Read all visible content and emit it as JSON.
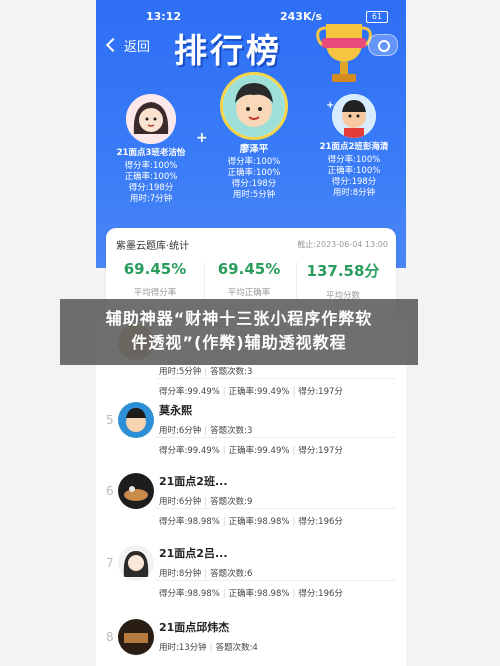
{
  "status_bar": {
    "time": "13:12",
    "network": "243K/s",
    "battery": "61"
  },
  "nav": {
    "back_label": "返回",
    "title": "排行榜"
  },
  "podium": [
    {
      "rank": 1,
      "name": "廖泽平",
      "score_rate": "得分率:100%",
      "correct_rate": "正确率:100%",
      "score": "得分:198分",
      "time": "用时:5分钟",
      "accent": "#f5d64a"
    },
    {
      "rank": 2,
      "name": "21面点3班老洁怡",
      "score_rate": "得分率:100%",
      "correct_rate": "正确率:100%",
      "score": "得分:198分",
      "time": "用时:7分钟",
      "accent": "#f0c0c8"
    },
    {
      "rank": 3,
      "name": "21面点2班彭海清",
      "score_rate": "得分率:100%",
      "correct_rate": "正确率:100%",
      "score": "得分:198分",
      "time": "用时:8分钟",
      "accent": "#f08a3c"
    }
  ],
  "summary": {
    "heading": "紫墨云题库·统计",
    "date": "截止:2023-06-04 13:00",
    "stats": [
      {
        "value": "69.45%",
        "label": "平均得分率"
      },
      {
        "value": "69.45%",
        "label": "平均正确率"
      },
      {
        "value": "137.58分",
        "label": "平均分数"
      }
    ]
  },
  "list": [
    {
      "rank": "4",
      "name": "",
      "time": "用时:5分钟",
      "attempts": "答题次数:3",
      "score_rate": "得分率:99.49%",
      "correct_rate": "正确率:99.49%",
      "score": "得分:197分"
    },
    {
      "rank": "5",
      "name": "莫永熙",
      "time": "用时:6分钟",
      "attempts": "答题次数:3",
      "score_rate": "得分率:99.49%",
      "correct_rate": "正确率:99.49%",
      "score": "得分:197分"
    },
    {
      "rank": "6",
      "name": "21面点2班...",
      "time": "用时:6分钟",
      "attempts": "答题次数:9",
      "score_rate": "得分率:98.98%",
      "correct_rate": "正确率:98.98%",
      "score": "得分:196分"
    },
    {
      "rank": "7",
      "name": "21面点2吕...",
      "time": "用时:8分钟",
      "attempts": "答题次数:6",
      "score_rate": "得分率:98.98%",
      "correct_rate": "正确率:98.98%",
      "score": "得分:196分"
    },
    {
      "rank": "8",
      "name": "21面点邱炜杰",
      "time": "用时:13分钟",
      "attempts": "答题次数:4",
      "score_rate": "",
      "correct_rate": "",
      "score": ""
    }
  ],
  "overlay_banner": {
    "line1": "辅助神器“财神十三张小程序作弊软",
    "line2": "件透视”(作弊)辅助透视教程"
  },
  "colors": {
    "brand_blue": "#2d6ef5",
    "stat_green": "#2a9d5c"
  }
}
